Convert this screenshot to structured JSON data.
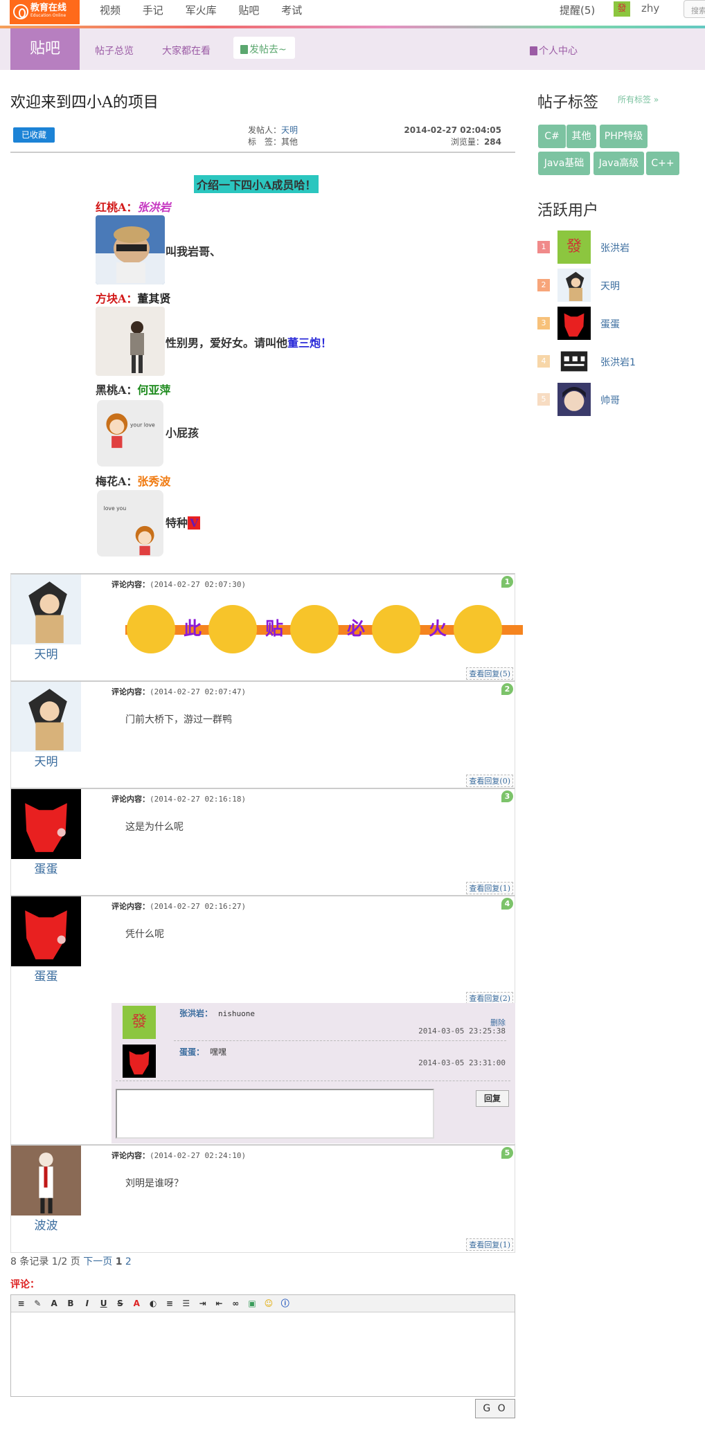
{
  "topbar": {
    "logo_title": "教育在线",
    "logo_sub": "Education Online",
    "nav": [
      "视频",
      "手记",
      "军火库",
      "贴吧",
      "考试"
    ],
    "remind": "提醒(5)",
    "username": "zhy",
    "search_placeholder": "搜索"
  },
  "subnav": {
    "brand": "贴吧",
    "items": [
      "帖子总览",
      "大家都在看"
    ],
    "post_button": "发帖去~",
    "user_center": "个人中心"
  },
  "post": {
    "title": "欢迎来到四小A的项目",
    "saved_label": "已收藏",
    "poster_label": "发帖人：",
    "poster": "天明",
    "tag_label": "标　签：",
    "tag": "其他",
    "date": "2014-02-27 02:04:05",
    "views_label": "浏览量：",
    "views": "284",
    "intro": "介绍一下四小A成员哈！",
    "members": [
      {
        "role": "红桃A：",
        "name": "张洪岩",
        "desc": "叫我岩哥、",
        "color": "#d21919",
        "name_color": "#c534c0"
      },
      {
        "role": "方块A：",
        "name": "董其贤",
        "desc": "性别男，爱好女。请叫他",
        "desc_highlight": "董三炮！",
        "color": "#d21919",
        "name_color": "#222"
      },
      {
        "role": "黑桃A：",
        "name": "何亚萍",
        "desc": "小屁孩",
        "color": "#333",
        "name_color": "#1c8a1c"
      },
      {
        "role": "梅花A：",
        "name": "张秀波",
        "desc": "特种",
        "desc_badge": "V",
        "color": "#333",
        "name_color": "#f07a10"
      }
    ]
  },
  "comments": {
    "label": "评论内容：",
    "reply_link_prefix": "查看回复",
    "items": [
      {
        "num": "1",
        "user": "天明",
        "time": "(2014-02-27 02:07:30)",
        "text": "",
        "fire_words": [
          "此",
          "贴",
          "必",
          "火"
        ],
        "replies": "(5)"
      },
      {
        "num": "2",
        "user": "天明",
        "time": "(2014-02-27 02:07:47)",
        "text": "门前大桥下，游过一群鸭",
        "replies": "(0)"
      },
      {
        "num": "3",
        "user": "蛋蛋",
        "time": "(2014-02-27 02:16:18)",
        "text": "这是为什么呢",
        "replies": "(1)"
      },
      {
        "num": "4",
        "user": "蛋蛋",
        "time": "(2014-02-27 02:16:27)",
        "text": "凭什么呢",
        "replies": "(2)"
      },
      {
        "num": "5",
        "user": "波波",
        "time": "(2014-02-27 02:24:10)",
        "text": "刘明是谁呀？",
        "replies": "(1)"
      }
    ],
    "sub_replies": [
      {
        "user": "张洪岩：",
        "text": "nishuone",
        "delete": "删除",
        "time": "2014-03-05 23:25:38"
      },
      {
        "user": "蛋蛋：",
        "text": "嘿嘿",
        "time": "2014-03-05 23:31:00"
      }
    ],
    "reply_button": "回复"
  },
  "pager": {
    "summary": "8 条记录 1/2 页",
    "next": "下一页",
    "pages": [
      "1",
      "2"
    ]
  },
  "editor": {
    "label": "评论：",
    "tools": [
      "≡",
      "✎",
      "A",
      "B",
      "I",
      "U",
      "S",
      "A",
      "◐",
      "≡",
      "☰",
      "⇥",
      "⇤",
      "∞",
      "▣",
      "☺",
      "ⓘ"
    ],
    "go": "G O"
  },
  "sidebar": {
    "tags_title": "帖子标签",
    "all_tags": "所有标签 »",
    "tags": [
      "C#",
      "其他",
      "PHP特级",
      "Java基础",
      "Java高级",
      "C++"
    ],
    "users_title": "活跃用户",
    "users": [
      {
        "rank": "1",
        "name": "张洪岩",
        "color": "#f08a8a"
      },
      {
        "rank": "2",
        "name": "天明",
        "color": "#f7a57a"
      },
      {
        "rank": "3",
        "name": "蛋蛋",
        "color": "#f7c17a"
      },
      {
        "rank": "4",
        "name": "张洪岩1",
        "color": "#f7d6a8"
      },
      {
        "rank": "5",
        "name": "帅哥",
        "color": "#f7dcc2"
      }
    ]
  },
  "colors": {
    "accent": "#b77fc0",
    "logo": "#ff6a1a",
    "tag": "#7cc3a1",
    "link": "#3a6c9e"
  }
}
